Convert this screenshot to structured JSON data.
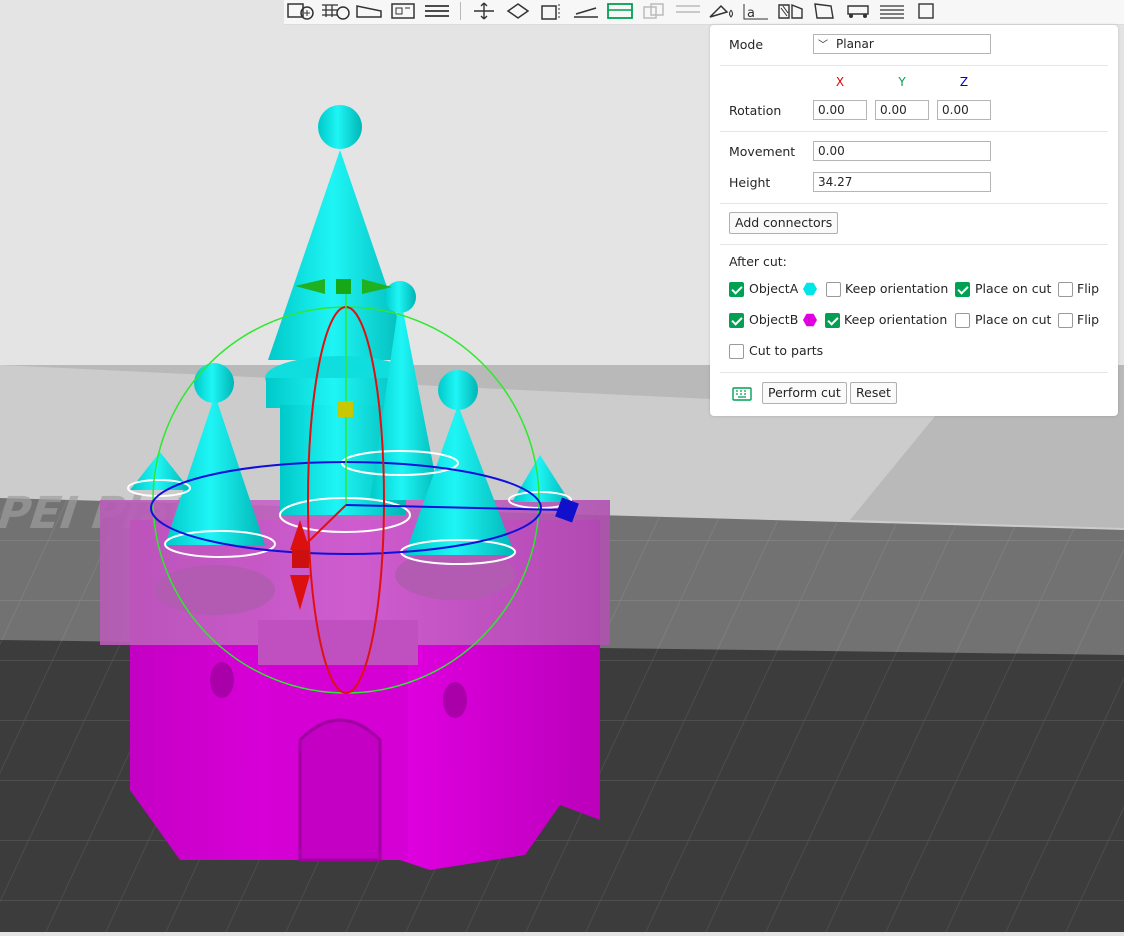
{
  "toolbar": {
    "icons": [
      "add-object-icon",
      "arrange-icon",
      "orient-icon",
      "layout-icon",
      "layers-icon",
      "move-icon",
      "rotate-icon",
      "scale-icon",
      "place-on-face-icon",
      "cut-icon",
      "mesh-boolean-icon",
      "support-paint-icon",
      "seam-paint-icon",
      "color-paint-icon",
      "text-icon",
      "assembly-icon",
      "measure-icon",
      "variable-layer-icon",
      "fuzzy-skin-icon",
      "more-icon"
    ],
    "active": "cut-icon"
  },
  "viewport": {
    "bed_text": "Ba   ed PEI Plate",
    "colors": {
      "part_a": "#00e5e5",
      "part_b": "#e000e0",
      "bed": "#3d3d3d",
      "background": "#e4e4e4"
    }
  },
  "panel": {
    "mode_label": "Mode",
    "mode_value": "Planar",
    "axis": {
      "x": "X",
      "y": "Y",
      "z": "Z"
    },
    "axis_colors": {
      "x": "#dd0000",
      "y": "#00a152",
      "z": "#0000cc"
    },
    "rotation_label": "Rotation",
    "rotation": {
      "x": "0.00",
      "y": "0.00",
      "z": "0.00"
    },
    "movement_label": "Movement",
    "movement": "0.00",
    "height_label": "Height",
    "height": "34.27",
    "add_connectors": "Add connectors",
    "after_cut_label": "After cut:",
    "object_a": {
      "label": "ObjectA",
      "checked": true,
      "color": "#00e5e5",
      "keep_orientation": "Keep orientation",
      "keep_checked": false,
      "place_on_cut": "Place on cut",
      "place_checked": true,
      "flip": "Flip",
      "flip_checked": false
    },
    "object_b": {
      "label": "ObjectB",
      "checked": true,
      "color": "#e000e0",
      "keep_orientation": "Keep orientation",
      "keep_checked": true,
      "place_on_cut": "Place on cut",
      "place_checked": false,
      "flip": "Flip",
      "flip_checked": false
    },
    "cut_to_parts": "Cut to parts",
    "cut_to_parts_checked": false,
    "perform_cut": "Perform cut",
    "reset": "Reset"
  }
}
